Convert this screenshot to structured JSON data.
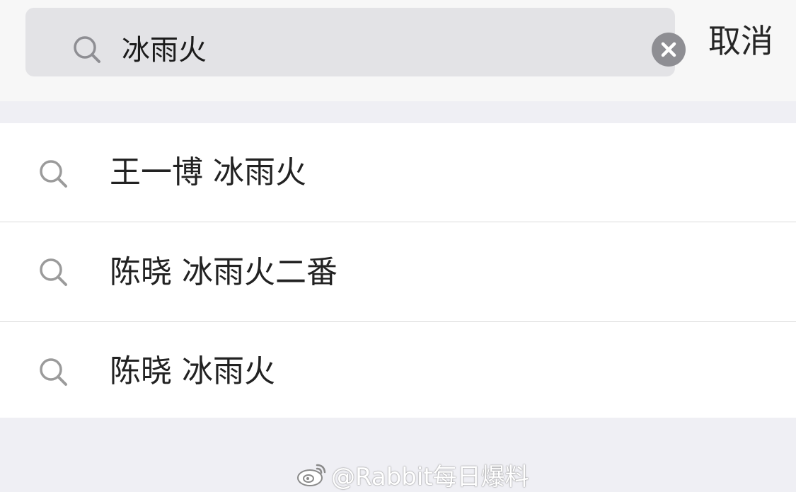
{
  "search": {
    "query": "冰雨火",
    "cancel_label": "取消"
  },
  "suggestions": [
    {
      "label": "王一博 冰雨火",
      "icon": "search-icon"
    },
    {
      "label": "陈晓 冰雨火二番",
      "icon": "search-icon"
    },
    {
      "label": "陈晓 冰雨火",
      "icon": "search-icon"
    }
  ],
  "watermark": {
    "text": "@Rabbit每日爆料",
    "icon": "weibo-logo"
  },
  "colors": {
    "page_background": "#efeff4",
    "search_field": "#e3e3e6",
    "clear_button": "#8e8e93",
    "icon_gray": "#9b9b9b",
    "divider": "#dcdcdc",
    "text": "#222222"
  }
}
